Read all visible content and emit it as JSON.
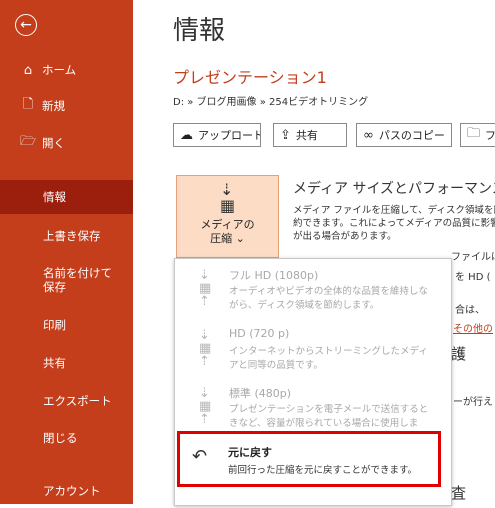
{
  "sidebar": {
    "back_icon": "arrow-left-icon",
    "items": [
      {
        "label": "ホーム",
        "icon": "home-icon"
      },
      {
        "label": "新規",
        "icon": "new-document-icon"
      },
      {
        "label": "開く",
        "icon": "open-folder-icon"
      },
      {
        "label": "情報"
      },
      {
        "label": "上書き保存"
      },
      {
        "label": "名前を付けて保存"
      },
      {
        "label": "印刷"
      },
      {
        "label": "共有"
      },
      {
        "label": "エクスポート"
      },
      {
        "label": "閉じる"
      },
      {
        "label": "アカウント"
      }
    ],
    "active": "情報"
  },
  "main": {
    "title": "情報",
    "doc_name": "プレゼンテーション1",
    "path": "D: » ブログ用画像 » 254ビデオトリミング",
    "buttons": {
      "upload": "アップロード",
      "share": "共有",
      "copy_path": "パスのコピー",
      "fourth": "フ"
    },
    "media_button": {
      "line1": "メディアの",
      "line2": "圧縮 ⌄"
    },
    "section_title": "メディア サイズとパフォーマンス",
    "section_desc": "メディア ファイルを圧縮して、ディスク領域を節約できます。これによってメディアの品質に影響が出る場合があります。",
    "bg_fragments": {
      "frag1": "ファイルは",
      "frag2": "を HD (",
      "frag3": "合は、",
      "frag4": "その他の",
      "frag5": "護",
      "frag6": "ーが行え",
      "frag7": "査"
    },
    "dropdown": {
      "options": [
        {
          "name": "フル HD (1080p)",
          "desc": "オーディオやビデオの全体的な品質を維持しながら、ディスク領域を節約します。"
        },
        {
          "name": "HD (720 p)",
          "desc": "インターネットからストリーミングしたメディアと同等の品質です。"
        },
        {
          "name": "標準 (480p)",
          "desc": "プレゼンテーションを電子メールで送信するときなど、容量が限られている場合に使用します。"
        }
      ],
      "undo": {
        "name": "元に戻す",
        "desc": "前回行った圧縮を元に戻すことができます。"
      }
    }
  },
  "colors": {
    "accent": "#c43e1c",
    "active": "#9c1f0e",
    "highlight": "#e00000",
    "media_btn_bg": "#fcdcc4"
  }
}
